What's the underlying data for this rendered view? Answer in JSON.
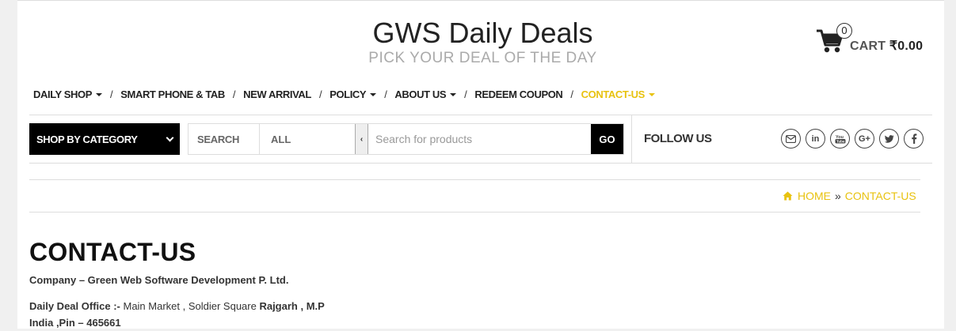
{
  "header": {
    "site_title": "GWS Daily Deals",
    "tagline": "PICK YOUR DEAL OF THE DAY",
    "cart_count": "0",
    "cart_label": "CART",
    "cart_amount": "₹0.00",
    "cart_icon": "shopping-cart-icon"
  },
  "nav": {
    "items": [
      {
        "label": "DAILY SHOP",
        "dropdown": true
      },
      {
        "label": "SMART PHONE & TAB",
        "dropdown": false
      },
      {
        "label": "NEW ARRIVAL",
        "dropdown": false
      },
      {
        "label": "POLICY",
        "dropdown": true
      },
      {
        "label": "ABOUT US",
        "dropdown": true
      },
      {
        "label": "REDEEM COUPON",
        "dropdown": false
      },
      {
        "label": "CONTACT-US",
        "dropdown": true,
        "active": true
      }
    ],
    "separator": "/"
  },
  "toolbar": {
    "category_button": "SHOP BY CATEGORY",
    "search_label": "SEARCH",
    "select_value": "ALL",
    "search_placeholder": "Search for products",
    "go_button": "GO",
    "follow_label": "FOLLOW US",
    "socials": [
      "email-icon",
      "linkedin-icon",
      "youtube-icon",
      "google-plus-icon",
      "twitter-icon",
      "facebook-icon"
    ]
  },
  "breadcrumb": {
    "home": "HOME",
    "separator": "»",
    "current": "CONTACT-US"
  },
  "content": {
    "title": "CONTACT-US",
    "company_line": "Company – Green Web Software Development P. Ltd.",
    "office_label": "Daily Deal Office :-",
    "office_text": " Main Market , Soldier Square ",
    "office_bold": "Rajgarh , M.P",
    "office_line2": "India ,Pin – 465661"
  },
  "colors": {
    "accent": "#e8c20f",
    "dark": "#000000"
  }
}
